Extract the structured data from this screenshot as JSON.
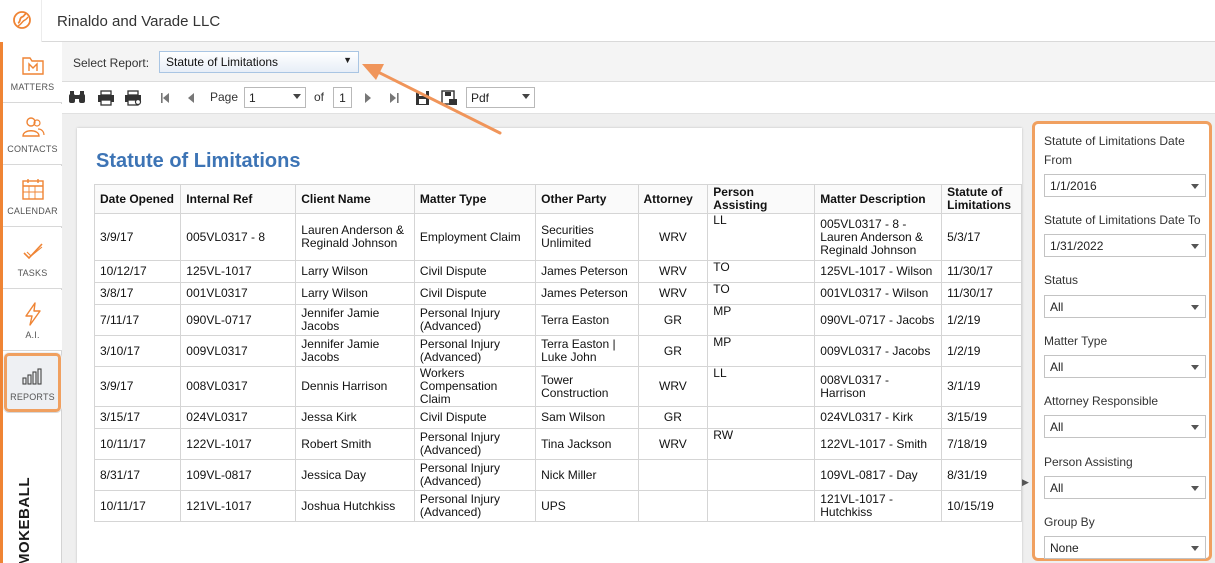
{
  "header": {
    "firm_name": "Rinaldo and Varade LLC"
  },
  "sidebar": {
    "items": [
      {
        "label": "MATTERS",
        "icon": "matters-icon"
      },
      {
        "label": "CONTACTS",
        "icon": "contacts-icon"
      },
      {
        "label": "CALENDAR",
        "icon": "calendar-icon"
      },
      {
        "label": "TASKS",
        "icon": "tasks-icon"
      },
      {
        "label": "A.I.",
        "icon": "lightning-icon"
      },
      {
        "label": "REPORTS",
        "icon": "reports-icon"
      }
    ],
    "brand": "MOKEBALL"
  },
  "report_select": {
    "label": "Select Report:",
    "value": "Statute of Limitations"
  },
  "toolbar": {
    "page_label": "Page",
    "page_value": "1",
    "of_label": "of",
    "total_pages": "1",
    "format_value": "Pdf"
  },
  "report": {
    "title": "Statute of Limitations",
    "columns": [
      "Date Opened",
      "Internal Ref",
      "Client Name",
      "Matter Type",
      "Other Party",
      "Attorney",
      "Person Assisting",
      "Matter Description",
      "Statute of Limitations"
    ],
    "rows": [
      [
        "3/9/17",
        "005VL0317 - 8",
        "Lauren Anderson & Reginald Johnson",
        "Employment Claim",
        "Securities Unlimited",
        "WRV",
        "LL",
        "005VL0317 - 8 - Lauren Anderson & Reginald Johnson",
        "5/3/17"
      ],
      [
        "10/12/17",
        "125VL-1017",
        "Larry Wilson",
        "Civil Dispute",
        "James Peterson",
        "WRV",
        "TO",
        "125VL-1017 - Wilson",
        "11/30/17"
      ],
      [
        "3/8/17",
        "001VL0317",
        "Larry Wilson",
        "Civil Dispute",
        "James Peterson",
        "WRV",
        "TO",
        "001VL0317 - Wilson",
        "11/30/17"
      ],
      [
        "7/11/17",
        "090VL-0717",
        "Jennifer Jamie Jacobs",
        "Personal Injury (Advanced)",
        "Terra Easton",
        "GR",
        "MP",
        "090VL-0717 - Jacobs",
        "1/2/19"
      ],
      [
        "3/10/17",
        "009VL0317",
        "Jennifer Jamie Jacobs",
        "Personal Injury (Advanced)",
        "Terra Easton | Luke John",
        "GR",
        "MP",
        "009VL0317 - Jacobs",
        "1/2/19"
      ],
      [
        "3/9/17",
        "008VL0317",
        "Dennis Harrison",
        "Workers Compensation Claim",
        "Tower Construction",
        "WRV",
        "LL",
        "008VL0317 - Harrison",
        "3/1/19"
      ],
      [
        "3/15/17",
        "024VL0317",
        "Jessa Kirk",
        "Civil Dispute",
        "Sam Wilson",
        "GR",
        "",
        "024VL0317 - Kirk",
        "3/15/19"
      ],
      [
        "10/11/17",
        "122VL-1017",
        "Robert Smith",
        "Personal Injury (Advanced)",
        "Tina Jackson",
        "WRV",
        "RW",
        "122VL-1017 - Smith",
        "7/18/19"
      ],
      [
        "8/31/17",
        "109VL-0817",
        "Jessica Day",
        "Personal Injury (Advanced)",
        "Nick Miller",
        "",
        "",
        "109VL-0817 - Day",
        "8/31/19"
      ],
      [
        "10/11/17",
        "121VL-1017",
        "Joshua Hutchkiss",
        "Personal Injury (Advanced)",
        "UPS",
        "",
        "",
        "121VL-1017 - Hutchkiss",
        "10/15/19"
      ]
    ]
  },
  "filters": [
    {
      "label": "Statute of Limitations Date From",
      "value": "1/1/2016"
    },
    {
      "label": "Statute of Limitations Date To",
      "value": "1/31/2022"
    },
    {
      "label": "Status",
      "value": "All"
    },
    {
      "label": "Matter Type",
      "value": "All"
    },
    {
      "label": "Attorney Responsible",
      "value": "All"
    },
    {
      "label": "Person Assisting",
      "value": "All"
    },
    {
      "label": "Group By",
      "value": "None"
    }
  ],
  "colors": {
    "accent": "#ef8434",
    "title_blue": "#3d74b5",
    "highlight": "#f0a060"
  }
}
